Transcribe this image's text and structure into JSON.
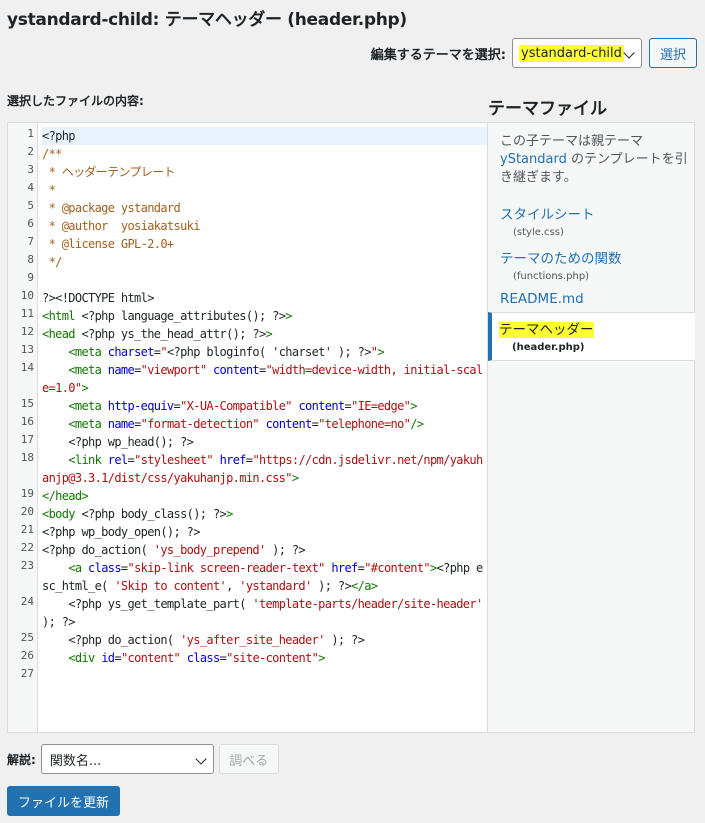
{
  "page": {
    "title": "ystandard-child: テーマヘッダー (header.php)"
  },
  "theme_selector": {
    "label": "編集するテーマを選択:",
    "selected": "ystandard-child",
    "button": "選択"
  },
  "editor": {
    "label": "選択したファイルの内容:",
    "lines": [
      {
        "n": "1",
        "active": true,
        "segs": [
          [
            "<?php",
            ""
          ]
        ]
      },
      {
        "n": "2",
        "segs": [
          [
            "/**",
            "c-comment"
          ]
        ]
      },
      {
        "n": "3",
        "segs": [
          [
            " * ヘッダーテンプレート",
            "c-comment"
          ]
        ]
      },
      {
        "n": "4",
        "segs": [
          [
            " *",
            "c-comment"
          ]
        ]
      },
      {
        "n": "5",
        "segs": [
          [
            " * @package ystandard",
            "c-comment"
          ]
        ]
      },
      {
        "n": "6",
        "segs": [
          [
            " * @author  yosiakatsuki",
            "c-comment"
          ]
        ]
      },
      {
        "n": "7",
        "segs": [
          [
            " * @license GPL-2.0+",
            "c-comment"
          ]
        ]
      },
      {
        "n": "8",
        "segs": [
          [
            " */",
            "c-comment"
          ]
        ]
      },
      {
        "n": "9",
        "segs": [
          [
            "",
            ""
          ]
        ]
      },
      {
        "n": "10",
        "segs": [
          [
            "?><!DOCTYPE html>",
            ""
          ]
        ]
      },
      {
        "n": "11",
        "segs": [
          [
            "<html",
            "c-tag"
          ],
          [
            " <?php language_attributes(); ?>",
            ""
          ],
          [
            ">",
            "c-tag"
          ]
        ]
      },
      {
        "n": "12",
        "segs": [
          [
            "<head",
            "c-tag"
          ],
          [
            " <?php ys_the_head_attr(); ?>",
            ""
          ],
          [
            ">",
            "c-tag"
          ]
        ]
      },
      {
        "n": "13",
        "segs": [
          [
            "    ",
            ""
          ],
          [
            "<meta",
            "c-tag"
          ],
          [
            " ",
            ""
          ],
          [
            "charset",
            "c-attr"
          ],
          [
            "=",
            ""
          ],
          [
            "\"",
            "c-str"
          ],
          [
            "<?php bloginfo( 'charset' ); ?>",
            ""
          ],
          [
            "\"",
            "c-str"
          ],
          [
            ">",
            "c-tag"
          ]
        ]
      },
      {
        "n": "14",
        "segs": [
          [
            "    ",
            ""
          ],
          [
            "<meta",
            "c-tag"
          ],
          [
            " ",
            ""
          ],
          [
            "name",
            "c-attr"
          ],
          [
            "=",
            ""
          ],
          [
            "\"viewport\"",
            "c-str"
          ],
          [
            " ",
            ""
          ],
          [
            "content",
            "c-attr"
          ],
          [
            "=",
            ""
          ],
          [
            "\"width=device-width, initial-scale=1.0\"",
            "c-str"
          ],
          [
            ">",
            "c-tag"
          ]
        ]
      },
      {
        "n": "15",
        "segs": [
          [
            "    ",
            ""
          ],
          [
            "<meta",
            "c-tag"
          ],
          [
            " ",
            ""
          ],
          [
            "http-equiv",
            "c-attr"
          ],
          [
            "=",
            ""
          ],
          [
            "\"X-UA-Compatible\"",
            "c-str"
          ],
          [
            " ",
            ""
          ],
          [
            "content",
            "c-attr"
          ],
          [
            "=",
            ""
          ],
          [
            "\"IE=edge\"",
            "c-str"
          ],
          [
            ">",
            "c-tag"
          ]
        ]
      },
      {
        "n": "16",
        "segs": [
          [
            "    ",
            ""
          ],
          [
            "<meta",
            "c-tag"
          ],
          [
            " ",
            ""
          ],
          [
            "name",
            "c-attr"
          ],
          [
            "=",
            ""
          ],
          [
            "\"format-detection\"",
            "c-str"
          ],
          [
            " ",
            ""
          ],
          [
            "content",
            "c-attr"
          ],
          [
            "=",
            ""
          ],
          [
            "\"telephone=no\"",
            "c-str"
          ],
          [
            "/>",
            "c-tag"
          ]
        ]
      },
      {
        "n": "17",
        "segs": [
          [
            "    <?php wp_head(); ?>",
            ""
          ]
        ]
      },
      {
        "n": "18",
        "segs": [
          [
            "    ",
            ""
          ],
          [
            "<link",
            "c-tag"
          ],
          [
            " ",
            ""
          ],
          [
            "rel",
            "c-attr"
          ],
          [
            "=",
            ""
          ],
          [
            "\"stylesheet\"",
            "c-str"
          ],
          [
            " ",
            ""
          ],
          [
            "href",
            "c-attr"
          ],
          [
            "=",
            ""
          ],
          [
            "\"https://cdn.jsdelivr.net/npm/yakuhanjp@3.3.1/dist/css/yakuhanjp.min.css\"",
            "c-str"
          ],
          [
            ">",
            "c-tag"
          ]
        ]
      },
      {
        "n": "19",
        "segs": [
          [
            "</head>",
            "c-tag"
          ]
        ]
      },
      {
        "n": "20",
        "segs": [
          [
            "<body",
            "c-tag"
          ],
          [
            " <?php body_class(); ?>",
            ""
          ],
          [
            ">",
            "c-tag"
          ]
        ]
      },
      {
        "n": "21",
        "segs": [
          [
            "<?php wp_body_open(); ?>",
            ""
          ]
        ]
      },
      {
        "n": "22",
        "segs": [
          [
            "<?php do_action( ",
            ""
          ],
          [
            "'ys_body_prepend'",
            "c-str"
          ],
          [
            " ); ?>",
            ""
          ]
        ]
      },
      {
        "n": "23",
        "segs": [
          [
            "    ",
            ""
          ],
          [
            "<a",
            "c-tag"
          ],
          [
            " ",
            ""
          ],
          [
            "class",
            "c-attr"
          ],
          [
            "=",
            ""
          ],
          [
            "\"skip-link screen-reader-text\"",
            "c-str"
          ],
          [
            " ",
            ""
          ],
          [
            "href",
            "c-attr"
          ],
          [
            "=",
            ""
          ],
          [
            "\"#content\"",
            "c-str"
          ],
          [
            ">",
            "c-tag"
          ],
          [
            "<?php esc_html_e( ",
            ""
          ],
          [
            "'Skip to content'",
            "c-str"
          ],
          [
            ", ",
            ""
          ],
          [
            "'ystandard'",
            "c-str"
          ],
          [
            " ); ?>",
            ""
          ],
          [
            "</a>",
            "c-tag"
          ]
        ]
      },
      {
        "n": "24",
        "segs": [
          [
            "    <?php ys_get_template_part( ",
            ""
          ],
          [
            "'template-parts/header/site-header'",
            "c-str"
          ],
          [
            " ); ?>",
            ""
          ]
        ]
      },
      {
        "n": "25",
        "segs": [
          [
            "    <?php do_action( ",
            ""
          ],
          [
            "'ys_after_site_header'",
            "c-str"
          ],
          [
            " ); ?>",
            ""
          ]
        ]
      },
      {
        "n": "26",
        "segs": [
          [
            "    ",
            ""
          ],
          [
            "<div",
            "c-tag"
          ],
          [
            " ",
            ""
          ],
          [
            "id",
            "c-attr"
          ],
          [
            "=",
            ""
          ],
          [
            "\"content\"",
            "c-str"
          ],
          [
            " ",
            ""
          ],
          [
            "class",
            "c-attr"
          ],
          [
            "=",
            ""
          ],
          [
            "\"site-content\"",
            "c-str"
          ],
          [
            ">",
            "c-tag"
          ]
        ]
      },
      {
        "n": "27",
        "segs": [
          [
            "",
            ""
          ]
        ]
      }
    ]
  },
  "sidebar": {
    "heading": "テーマファイル",
    "desc_before": "この子テーマは親テーマ",
    "desc_parent": "yStandard",
    "desc_after": "のテンプレートを引き継ぎます。",
    "files": [
      {
        "label": "スタイルシート",
        "file": "(style.css)"
      },
      {
        "label": "テーマのための関数",
        "file": "(functions.php)"
      },
      {
        "label": "README.md",
        "file": ""
      },
      {
        "label": "テーマヘッダー",
        "file": "(header.php)"
      }
    ]
  },
  "documentation": {
    "label": "解説:",
    "placeholder": "関数名...",
    "button": "調べる"
  },
  "update_button": "ファイルを更新",
  "colors": {
    "accent": "#2271b1",
    "highlight": "#ffff33"
  }
}
